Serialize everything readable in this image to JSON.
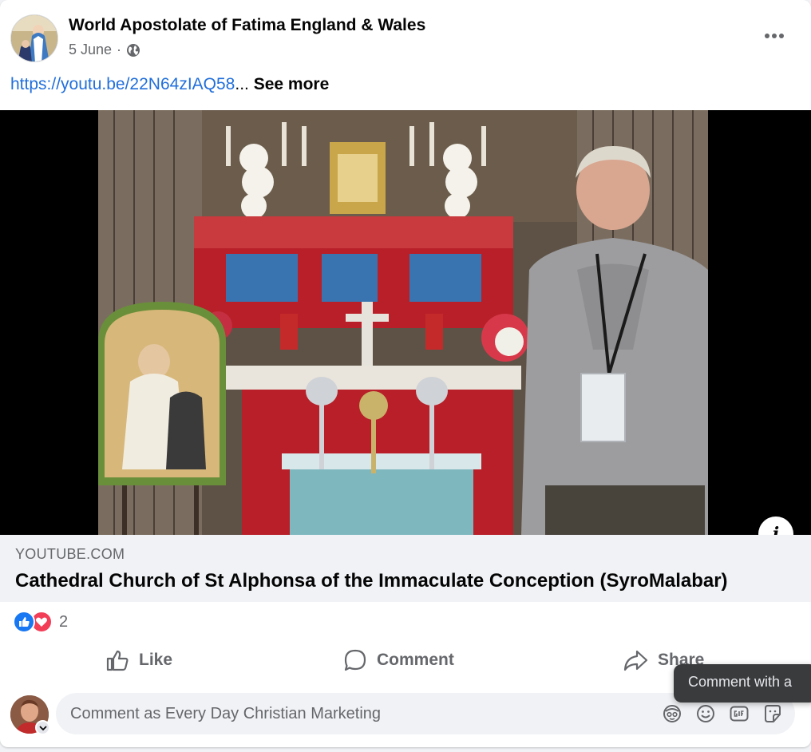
{
  "post": {
    "page_name": "World Apostolate of Fatima England & Wales",
    "date": "5 June",
    "separator": "·",
    "privacy_icon": "globe-icon",
    "link_text": "https://youtu.be/22N64zIAQ58",
    "ellipsis": "...",
    "see_more": "See more",
    "more_icon": "more-dots-icon"
  },
  "link_preview": {
    "domain": "YOUTUBE.COM",
    "title": "Cathedral Church of St Alphonsa of the Immaculate Conception (SyroMalabar)",
    "info_icon": "i"
  },
  "reactions": {
    "types": [
      "like",
      "love"
    ],
    "count": "2"
  },
  "actions": {
    "like": "Like",
    "comment": "Comment",
    "share": "Share"
  },
  "tooltip": "Comment with a",
  "composer": {
    "placeholder": "Comment as Every Day Christian Marketing",
    "icons": [
      "avatar-sticker-icon",
      "emoji-icon",
      "gif-icon",
      "sticker-icon"
    ]
  },
  "colors": {
    "link": "#216fdb",
    "like_blue": "#1877f2",
    "love_red": "#f33e58",
    "secondary_text": "#65676b"
  }
}
